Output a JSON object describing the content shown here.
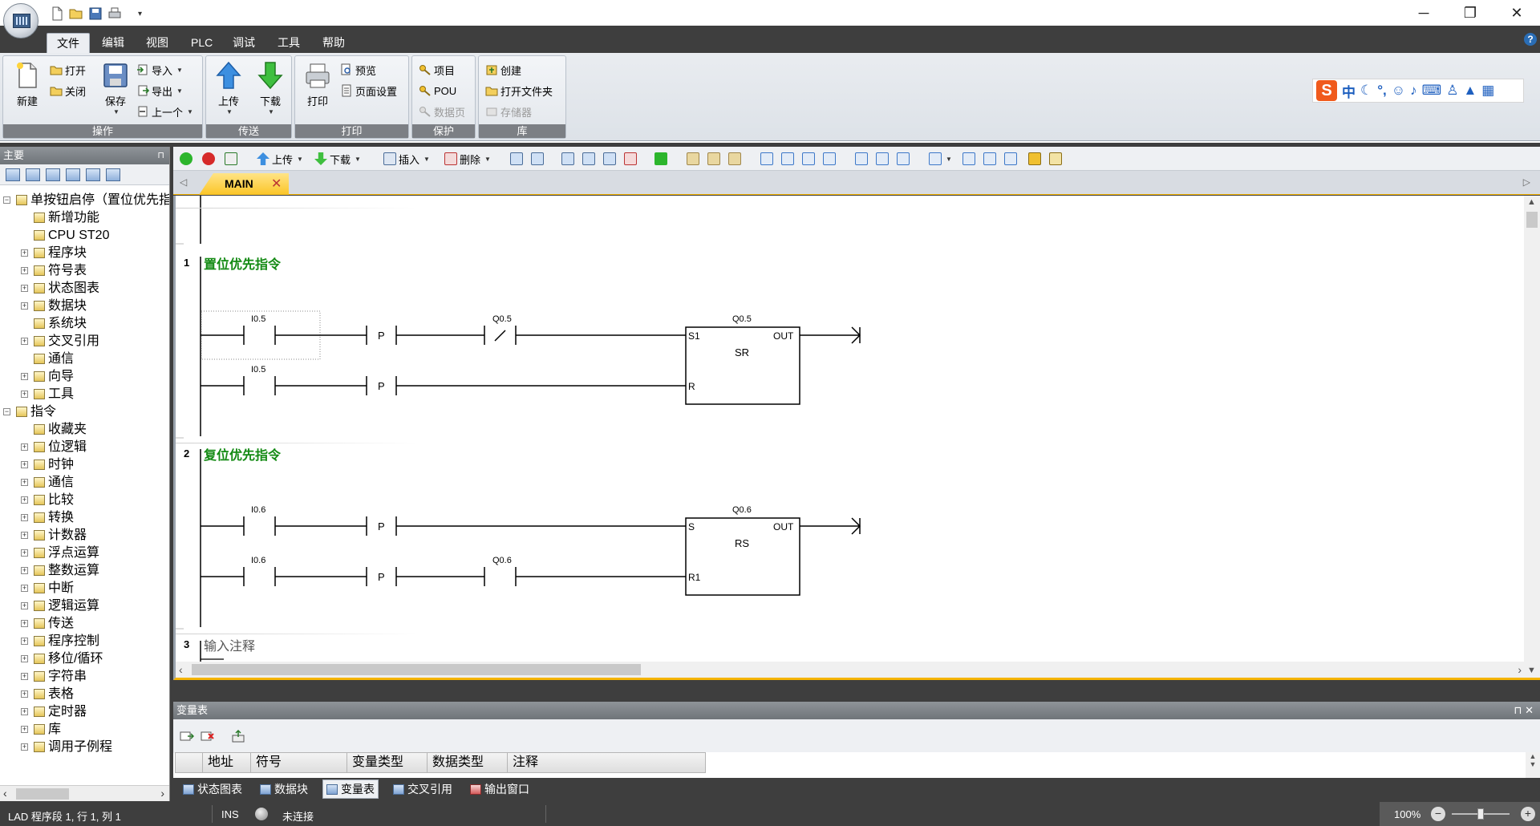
{
  "titlebar": {
    "quick_access": [
      "new-file-icon",
      "open-folder-icon",
      "save-icon",
      "print-icon"
    ],
    "qat_more": "▾",
    "minimize": "─",
    "restore": "❐",
    "close": "✕"
  },
  "ribbon_tabs": [
    "文件",
    "编辑",
    "视图",
    "PLC",
    "调试",
    "工具",
    "帮助"
  ],
  "ribbon": {
    "operation": {
      "label": "操作",
      "new": "新建",
      "open": "打开",
      "close": "关闭",
      "save": "保存",
      "import": "导入",
      "export": "导出",
      "previous": "上一个"
    },
    "transfer": {
      "label": "传送",
      "upload": "上传",
      "download": "下载"
    },
    "print": {
      "label": "打印",
      "print": "打印",
      "preview": "预览",
      "page_setup": "页面设置"
    },
    "protect": {
      "label": "保护",
      "project": "项目",
      "pou": "POU",
      "data_page": "数据页"
    },
    "library": {
      "label": "库",
      "create": "创建",
      "open_folder": "打开文件夹",
      "memory": "存储器"
    }
  },
  "ime": {
    "mode": "中"
  },
  "left_panel": {
    "title": "主要",
    "pin": "⊓",
    "tree": [
      {
        "label": "单按钮启停（置位优先指",
        "level": 0,
        "expander": "−"
      },
      {
        "label": "新增功能",
        "level": 1
      },
      {
        "label": "CPU ST20",
        "level": 1
      },
      {
        "label": "程序块",
        "level": 1,
        "expander": "+"
      },
      {
        "label": "符号表",
        "level": 1,
        "expander": "+"
      },
      {
        "label": "状态图表",
        "level": 1,
        "expander": "+"
      },
      {
        "label": "数据块",
        "level": 1,
        "expander": "+"
      },
      {
        "label": "系统块",
        "level": 1
      },
      {
        "label": "交叉引用",
        "level": 1,
        "expander": "+"
      },
      {
        "label": "通信",
        "level": 1
      },
      {
        "label": "向导",
        "level": 1,
        "expander": "+"
      },
      {
        "label": "工具",
        "level": 1,
        "expander": "+"
      },
      {
        "label": "指令",
        "level": 0,
        "expander": "−"
      },
      {
        "label": "收藏夹",
        "level": 1
      },
      {
        "label": "位逻辑",
        "level": 1,
        "expander": "+"
      },
      {
        "label": "时钟",
        "level": 1,
        "expander": "+"
      },
      {
        "label": "通信",
        "level": 1,
        "expander": "+"
      },
      {
        "label": "比较",
        "level": 1,
        "expander": "+"
      },
      {
        "label": "转换",
        "level": 1,
        "expander": "+"
      },
      {
        "label": "计数器",
        "level": 1,
        "expander": "+"
      },
      {
        "label": "浮点运算",
        "level": 1,
        "expander": "+"
      },
      {
        "label": "整数运算",
        "level": 1,
        "expander": "+"
      },
      {
        "label": "中断",
        "level": 1,
        "expander": "+"
      },
      {
        "label": "逻辑运算",
        "level": 1,
        "expander": "+"
      },
      {
        "label": "传送",
        "level": 1,
        "expander": "+"
      },
      {
        "label": "程序控制",
        "level": 1,
        "expander": "+"
      },
      {
        "label": "移位/循环",
        "level": 1,
        "expander": "+"
      },
      {
        "label": "字符串",
        "level": 1,
        "expander": "+"
      },
      {
        "label": "表格",
        "level": 1,
        "expander": "+"
      },
      {
        "label": "定时器",
        "level": 1,
        "expander": "+"
      },
      {
        "label": "库",
        "level": 1,
        "expander": "+"
      },
      {
        "label": "调用子例程",
        "level": 1,
        "expander": "+"
      }
    ]
  },
  "editor_toolbar": {
    "upload": "上传",
    "download": "下载",
    "insert": "插入",
    "delete": "删除"
  },
  "editor": {
    "tab": "MAIN",
    "tab_close": "✕",
    "networks": [
      {
        "number": "1",
        "title": "置位优先指令"
      },
      {
        "number": "2",
        "title": "复位优先指令"
      },
      {
        "number": "3",
        "comment": "输入注释"
      }
    ],
    "ladder": {
      "n1_contact_top": "I0.5",
      "n1_contact_bottom": "I0.5",
      "n1_nc_contact": "Q0.5",
      "n1_coil": "Q0.5",
      "n1_block": "SR",
      "n1_pin_set": "S1",
      "n1_pin_reset": "R",
      "n1_pin_out": "OUT",
      "n2_contact_top": "I0.6",
      "n2_contact_bottom": "I0.6",
      "n2_no_contact": "Q0.6",
      "n2_coil": "Q0.6",
      "n2_block": "RS",
      "n2_pin_set": "S",
      "n2_pin_reset": "R1",
      "n2_pin_out": "OUT",
      "p_label": "P",
      "nc_symbol": "/"
    }
  },
  "var_table": {
    "title": "变量表",
    "controls": "⊓  ✕",
    "columns": [
      "地址",
      "符号",
      "变量类型",
      "数据类型",
      "注释"
    ]
  },
  "bottom_tabs": [
    "状态图表",
    "数据块",
    "变量表",
    "交叉引用",
    "输出窗口"
  ],
  "status": {
    "position": "LAD 程序段 1, 行 1, 列 1",
    "mode": "INS",
    "connection": "未连接",
    "zoom": "100%"
  }
}
